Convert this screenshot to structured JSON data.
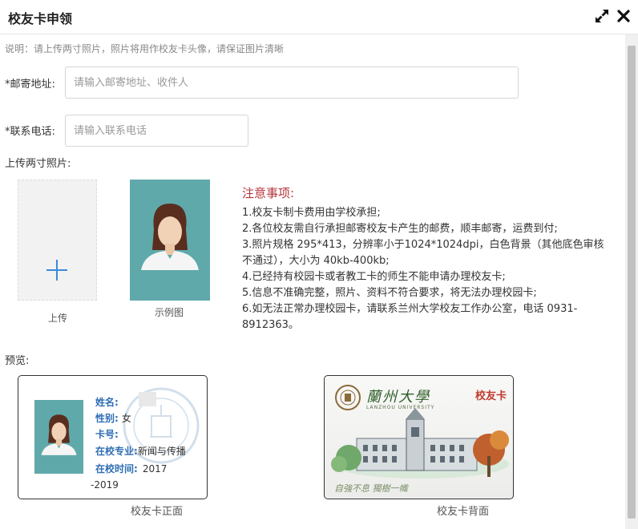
{
  "dialog": {
    "title": "校友卡申领",
    "maximize_icon": "expand-arrows-icon",
    "close_icon": "close-x-icon"
  },
  "note": "说明：请上传两寸照片，照片将用作校友卡头像，请保证图片清晰",
  "form": {
    "address": {
      "label": "*邮寄地址:",
      "placeholder": "请输入邮寄地址、收件人",
      "value": ""
    },
    "phone": {
      "label": "*联系电话:",
      "placeholder": "请输入联系电话",
      "value": ""
    }
  },
  "photo": {
    "section_label": "上传两寸照片:",
    "upload_caption": "上传",
    "sample_caption": "示例图",
    "upload_icon": "plus-icon"
  },
  "notice": {
    "title": "注意事项:",
    "items": [
      "1.校友卡制卡费用由学校承担;",
      "2.各位校友需自行承担邮寄校友卡产生的邮费，顺丰邮寄，运费到付;",
      "3.照片规格 295*413，分辨率小于1024*1024dpi，白色背景（其他底色审核不通过），大小为 40kb-400kb;",
      "4.已经持有校园卡或者教工卡的师生不能申请办理校友卡;",
      "5.信息不准确完整，照片、资料不符合要求，将无法办理校园卡;",
      "6.如无法正常办理校园卡，请联系兰州大学校友工作办公室，电话 0931-8912363。"
    ]
  },
  "preview": {
    "label": "预览:",
    "front": {
      "caption": "校友卡正面",
      "name_label": "姓名:",
      "name_value": "",
      "gender_label": "性别:",
      "gender_value": "女",
      "card_no_label": "卡号:",
      "card_no_value": "",
      "major_label": "在校专业:",
      "major_value": "新闻与传播",
      "period_label": "在校时间:",
      "period_value": "2017",
      "period_value2": "-2019"
    },
    "back": {
      "caption": "校友卡背面",
      "school_name": "蘭州大學",
      "school_name_en": "LANZHOU UNIVERSITY",
      "card_kind": "校友卡",
      "motto": "自強不息 獨樹一幟"
    }
  },
  "colors": {
    "notice_title": "#b5343a",
    "field_label": "#2d6db3",
    "photo_bg": "#5fa9ab",
    "upload_plus": "#3a8ad8"
  }
}
